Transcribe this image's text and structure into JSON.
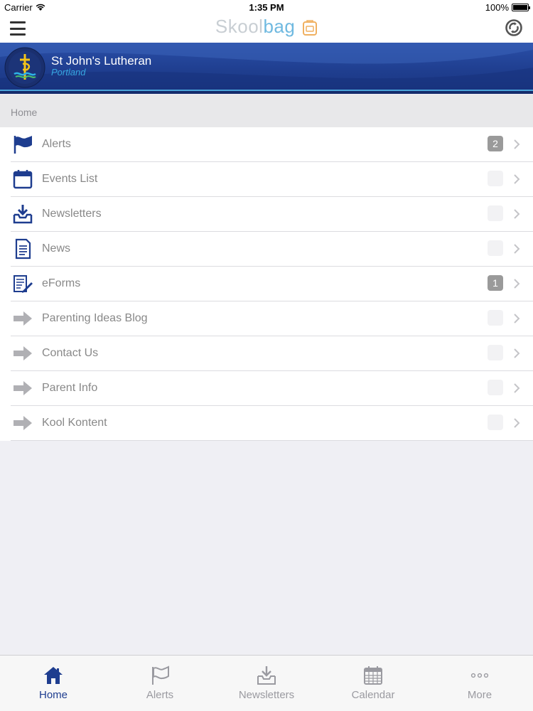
{
  "status_bar": {
    "carrier": "Carrier",
    "time": "1:35 PM",
    "battery": "100%"
  },
  "nav": {
    "brand_part1": "Skool",
    "brand_part2": "bag"
  },
  "school": {
    "name": "St John's Lutheran",
    "location": "Portland"
  },
  "breadcrumb": {
    "label": "Home"
  },
  "menu": [
    {
      "label": "Alerts",
      "icon": "flag-icon",
      "badge": "2"
    },
    {
      "label": "Events List",
      "icon": "calendar-icon",
      "badge": "0"
    },
    {
      "label": "Newsletters",
      "icon": "inbox-download-icon",
      "badge": "0"
    },
    {
      "label": "News",
      "icon": "document-icon",
      "badge": "0"
    },
    {
      "label": "eForms",
      "icon": "form-pen-icon",
      "badge": "1"
    },
    {
      "label": "Parenting Ideas Blog",
      "icon": "arrow-right-icon",
      "badge": "0"
    },
    {
      "label": "Contact Us",
      "icon": "arrow-right-icon",
      "badge": "0"
    },
    {
      "label": "Parent Info",
      "icon": "arrow-right-icon",
      "badge": "0"
    },
    {
      "label": "Kool Kontent",
      "icon": "arrow-right-icon",
      "badge": "0"
    }
  ],
  "tabs": [
    {
      "label": "Home",
      "icon": "home-icon",
      "active": true
    },
    {
      "label": "Alerts",
      "icon": "flag-icon",
      "active": false
    },
    {
      "label": "Newsletters",
      "icon": "inbox-download-icon",
      "active": false
    },
    {
      "label": "Calendar",
      "icon": "calendar-grid-icon",
      "active": false
    },
    {
      "label": "More",
      "icon": "more-dots-icon",
      "active": false
    }
  ],
  "colors": {
    "primary": "#1e3d8f",
    "accent": "#37a7e0",
    "badge": "#9a9a9a",
    "inactive": "#9a9aa0"
  }
}
